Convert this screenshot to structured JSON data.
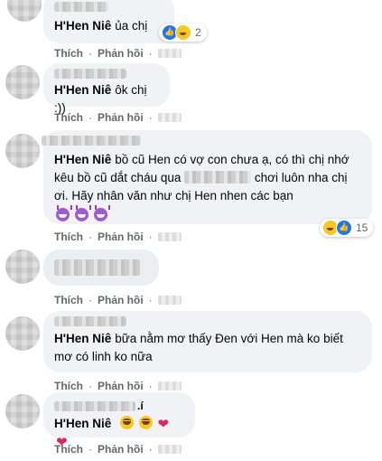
{
  "comments": [
    {
      "author": "H'Hen Niê",
      "text": "ủa chị",
      "reactions": {
        "icons": [
          "like-icon",
          "haha-icon"
        ],
        "count": "2"
      }
    },
    {
      "author": "H'Hen Niê",
      "text": "ôk chị :))",
      "actions": {
        "like": "Thích",
        "reply": "Phản hồi"
      }
    },
    {
      "author": "H'Hen Niê",
      "text_part1": "bồ cũ Hen có vợ con chưa ạ, có thì chị nhớ kêu bồ cũ dắt cháu qua",
      "text_part2": "chơi luôn nha chị ơi. Hãy nhân văn như chị Hen nhen các bạn",
      "emojis": [
        "devil-grin-emoji",
        "devil-grin-emoji",
        "devil-grin-emoji"
      ],
      "reactions": {
        "icons": [
          "haha-icon",
          "like-icon"
        ],
        "count": "15"
      },
      "actions": {
        "like": "Thích",
        "reply": "Phản hồi"
      }
    },
    {
      "actions": {
        "like": "Thích",
        "reply": "Phản hồi"
      }
    },
    {
      "author": "H'Hen Niê",
      "text": "bữa nằm mơ thấy Đen với Hen mà ko biết mơ có linh ko nữa",
      "actions": {
        "like": "Thích",
        "reply": "Phản hồi"
      }
    },
    {
      "author_suffix": ".í",
      "author": "H'Hen Niê",
      "emojis": [
        "grin-emoji",
        "grin-emoji",
        "heart",
        "heart"
      ],
      "heart_char": "❤",
      "actions": {
        "like": "Thích",
        "reply": "Phản hồi"
      }
    }
  ],
  "first_actions": {
    "like": "Thích",
    "reply": "Phản hồi"
  },
  "colors": {
    "bubble": "#f0f2f5",
    "mention": "#050505",
    "action": "#65676b",
    "like": "#1877f2",
    "haha": "#f7c81e",
    "heart": "#e0245e"
  }
}
